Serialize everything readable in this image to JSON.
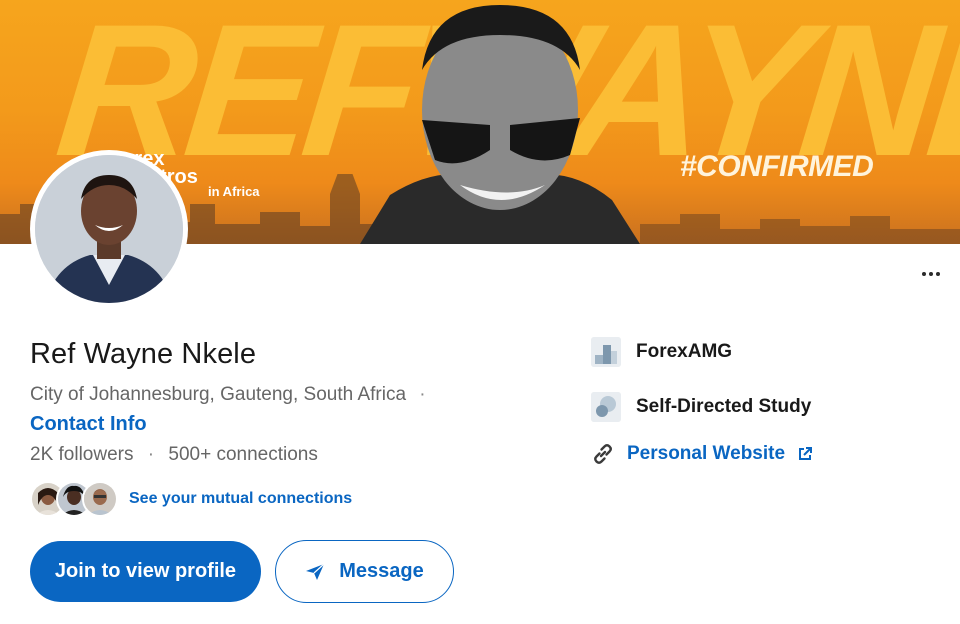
{
  "banner": {
    "big_text": "REFWAYNE",
    "forex_line1": "Forex",
    "forex_line2": "Maestros",
    "forex_line3": "in Africa",
    "hashtag": "#CONFIRMED"
  },
  "profile": {
    "name": "Ref Wayne Nkele",
    "location": "City of Johannesburg, Gauteng, South Africa",
    "location_separator": "·",
    "contact_info": "Contact Info",
    "followers": "2K followers",
    "stats_separator": "·",
    "connections": "500+ connections",
    "mutual_label": "See your mutual connections"
  },
  "actions": {
    "join_label": "Join to view profile",
    "message_label": "Message"
  },
  "side": {
    "company": "ForexAMG",
    "education": "Self-Directed Study",
    "website": "Personal Website"
  },
  "icons": {
    "more": "more-horizontal-icon",
    "send": "paper-plane-icon",
    "link": "link-icon",
    "external": "external-link-icon"
  },
  "colors": {
    "brand": "#0a66c2",
    "banner": "#f39a1b",
    "text_secondary": "#666666"
  }
}
